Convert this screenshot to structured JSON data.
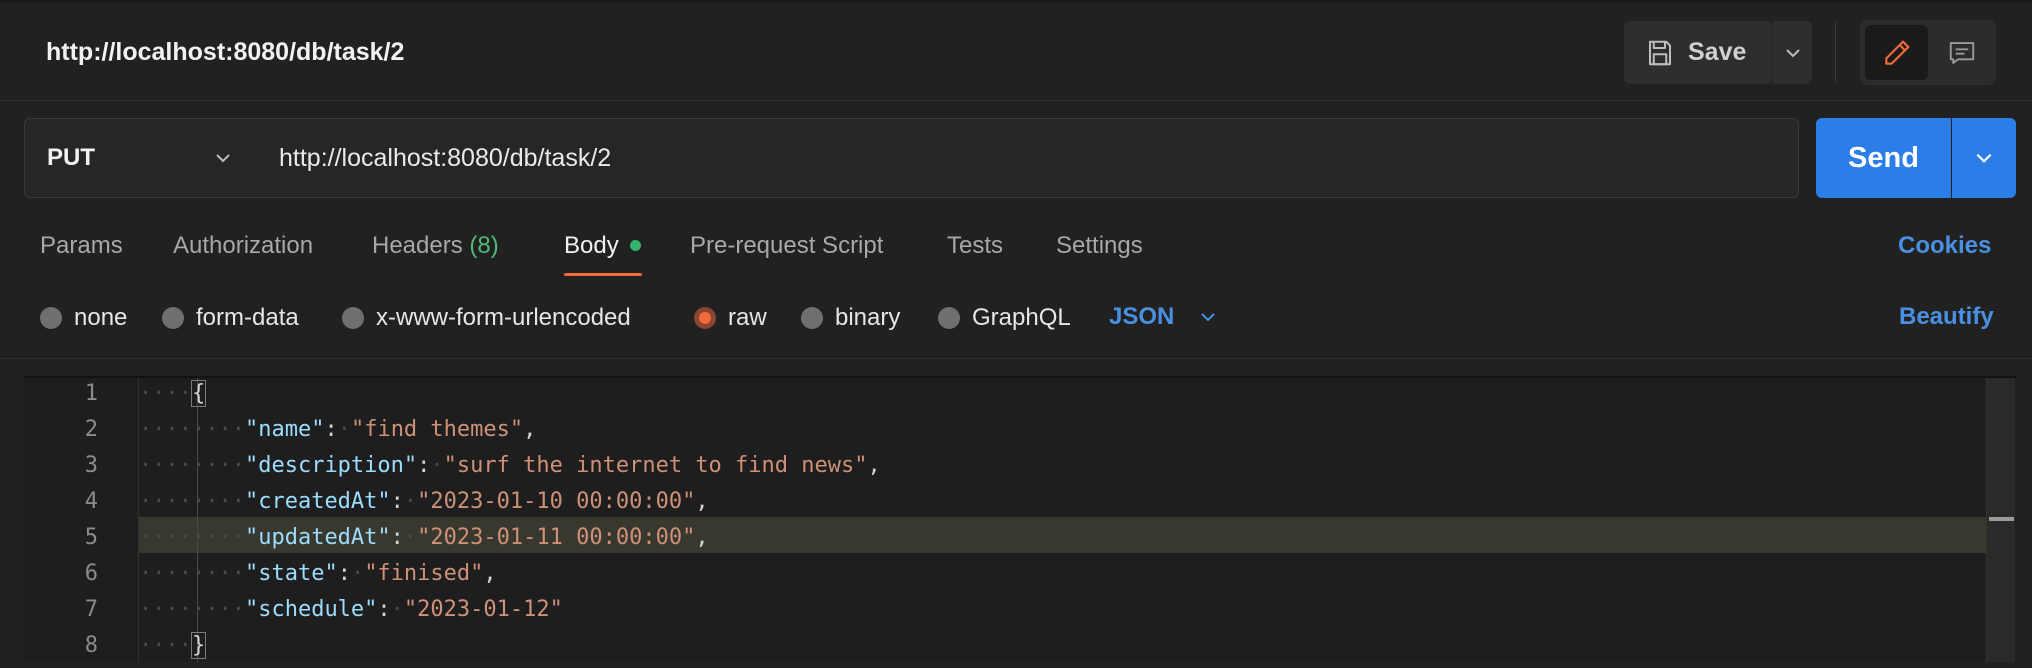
{
  "header": {
    "request_title": "http://localhost:8080/db/task/2",
    "save_label": "Save"
  },
  "request": {
    "method": "PUT",
    "url": "http://localhost:8080/db/task/2",
    "send_label": "Send"
  },
  "tabs": [
    {
      "label": "Params"
    },
    {
      "label": "Authorization"
    },
    {
      "label": "Headers",
      "count": "(8)"
    },
    {
      "label": "Body",
      "active": true
    },
    {
      "label": "Pre-request Script"
    },
    {
      "label": "Tests"
    },
    {
      "label": "Settings"
    }
  ],
  "cookies_label": "Cookies",
  "body_options": {
    "types": [
      "none",
      "form-data",
      "x-www-form-urlencoded",
      "raw",
      "binary",
      "GraphQL"
    ],
    "selected": "raw",
    "format": "JSON",
    "beautify_label": "Beautify"
  },
  "editor": {
    "line_numbers": [
      "1",
      "2",
      "3",
      "4",
      "5",
      "6",
      "7",
      "8"
    ],
    "highlighted_line": 5,
    "lines": [
      {
        "open": "{"
      },
      {
        "key": "\"name\"",
        "value": "\"find themes\"",
        "comma": ","
      },
      {
        "key": "\"description\"",
        "value": "\"surf the internet to find news\"",
        "comma": ","
      },
      {
        "key": "\"createdAt\"",
        "value": "\"2023-01-10 00:00:00\"",
        "comma": ","
      },
      {
        "key": "\"updatedAt\"",
        "value": "\"2023-01-11 00:00:00\"",
        "comma": ","
      },
      {
        "key": "\"state\"",
        "value": "\"finised\"",
        "comma": ","
      },
      {
        "key": "\"schedule\"",
        "value": "\"2023-01-12\"",
        "comma": ""
      },
      {
        "close": "}"
      }
    ]
  },
  "icons": {
    "save": "save-icon",
    "edit": "pencil-icon",
    "comment": "comment-icon",
    "caret": "chevron-down-icon"
  },
  "colors": {
    "accent_blue": "#2b7de8",
    "link_blue": "#4a90e2",
    "active_orange": "#f26b3a",
    "status_green": "#33b36b"
  }
}
